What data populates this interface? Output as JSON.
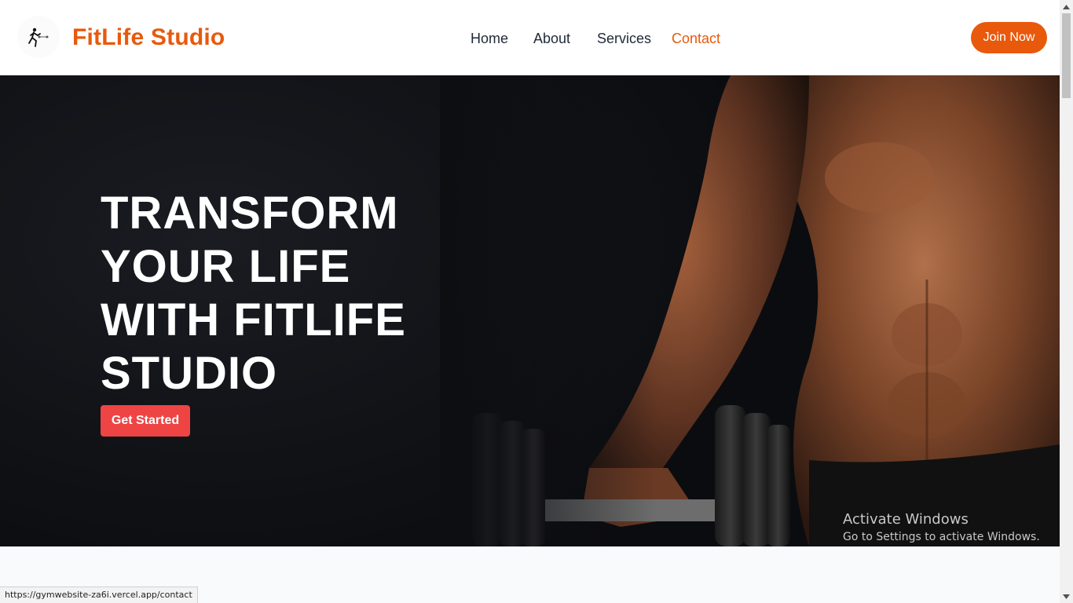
{
  "header": {
    "brand": "FitLife Studio",
    "logo_icon": "runner-logo-icon",
    "nav": [
      {
        "label": "Home",
        "active": false
      },
      {
        "label": "About",
        "active": false
      },
      {
        "label": "Services",
        "active": false
      },
      {
        "label": "Contact",
        "active": true
      }
    ],
    "cta_label": "Join Now"
  },
  "hero": {
    "title": "TRANSFORM YOUR LIFE WITH FITLIFE STUDIO",
    "cta_label": "Get Started",
    "image_subject": "muscular-man-lifting-dumbbell-image"
  },
  "watermark": {
    "title": "Activate Windows",
    "subtitle": "Go to Settings to activate Windows."
  },
  "status_bar": {
    "url": "https://gymwebsite-za6i.vercel.app/contact"
  },
  "colors": {
    "brand": "#e8590c",
    "cta": "#ef4444",
    "hero_bg": "#0b0c0f"
  }
}
